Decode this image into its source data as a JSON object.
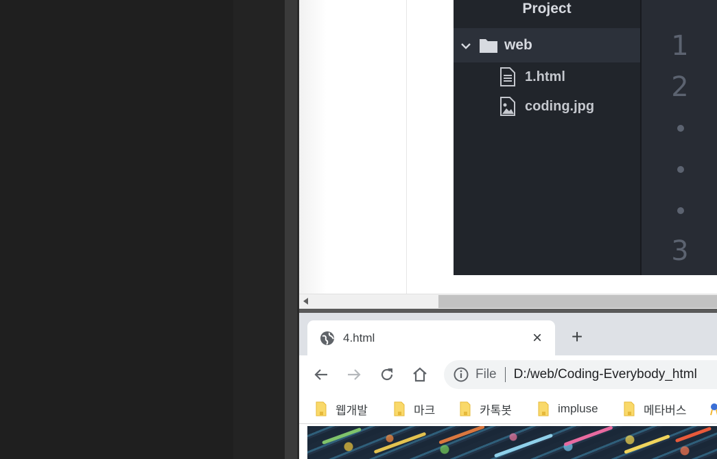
{
  "editor": {
    "panel_title": "Project",
    "tree": {
      "folder_label": "web",
      "files": [
        {
          "label": "1.html",
          "icon": "file-text-icon"
        },
        {
          "label": "coding.jpg",
          "icon": "file-image-icon"
        }
      ]
    },
    "gutter": {
      "line_numbers": [
        "1",
        "2",
        "3"
      ]
    },
    "colors": {
      "panel_bg": "#21252b",
      "gutter_bg": "#282c34",
      "text": "#d7dae0",
      "line_number": "#5c6370"
    }
  },
  "browser": {
    "tab": {
      "title": "4.html",
      "close_label": "×"
    },
    "new_tab_label": "+",
    "address": {
      "scheme_label": "File",
      "url": "D:/web/Coding-Everybody_html"
    },
    "bookmarks": [
      "웹개발",
      "마크",
      "카톡봇",
      "impluse",
      "메타버스"
    ]
  }
}
